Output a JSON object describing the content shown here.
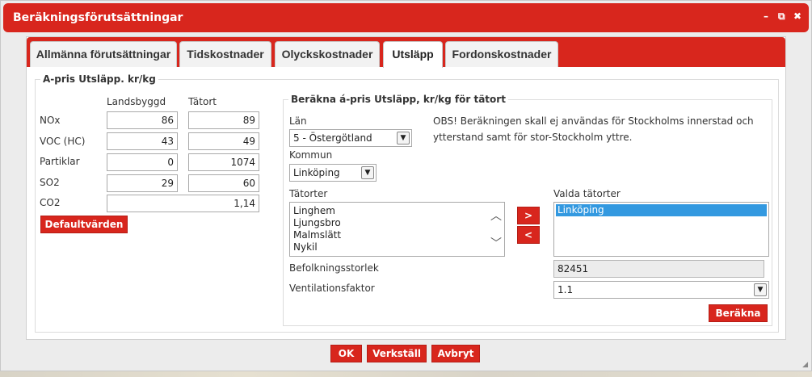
{
  "window": {
    "title": "Beräkningsförutsättningar",
    "controls": [
      "–",
      "⧉",
      "✖"
    ]
  },
  "tabs": [
    {
      "label": "Allmänna förutsättningar"
    },
    {
      "label": "Tidskostnader"
    },
    {
      "label": "Olyckskostnader"
    },
    {
      "label": "Utsläpp",
      "active": true
    },
    {
      "label": "Fordonskostnader"
    }
  ],
  "apris": {
    "legend": "A-pris Utsläpp. kr/kg",
    "col_landsbygd": "Landsbyggd",
    "col_tatort": "Tätort",
    "rows": [
      {
        "label": "NOx",
        "landsbygd": "86",
        "tatort": "89"
      },
      {
        "label": "VOC (HC)",
        "landsbygd": "43",
        "tatort": "49"
      },
      {
        "label": "Partiklar",
        "landsbygd": "0",
        "tatort": "1074"
      },
      {
        "label": "SO2",
        "landsbygd": "29",
        "tatort": "60"
      }
    ],
    "co2_label": "CO2",
    "co2_value": "1,14",
    "default_button": "Defaultvärden"
  },
  "berakna": {
    "legend": "Beräkna á-pris Utsläpp, kr/kg för tätort",
    "lan_label": "Län",
    "lan_value": "5 - Östergötland",
    "kommun_label": "Kommun",
    "kommun_value": "Linköping",
    "note_line1": "OBS! Beräkningen skall ej användas för Stockholms innerstad och",
    "note_line2": "ytterstand samt för stor-Stockholm yttre.",
    "tatorter_label": "Tätorter",
    "tatorter": [
      "Linghem",
      "Ljungsbro",
      "Malmslätt",
      "Nykil"
    ],
    "valda_label": "Valda tätorter",
    "valda": [
      "Linköping"
    ],
    "add_button": ">",
    "remove_button": "<",
    "befolkning_label": "Befolkningsstorlek",
    "befolkning_value": "82451",
    "ventilation_label": "Ventilationsfaktor",
    "ventilation_value": "1.1",
    "calc_button": "Beräkna"
  },
  "footer": {
    "ok": "OK",
    "apply": "Verkställ",
    "cancel": "Avbryt"
  },
  "colors": {
    "accent": "#d8261d",
    "selection": "#3399e0"
  }
}
